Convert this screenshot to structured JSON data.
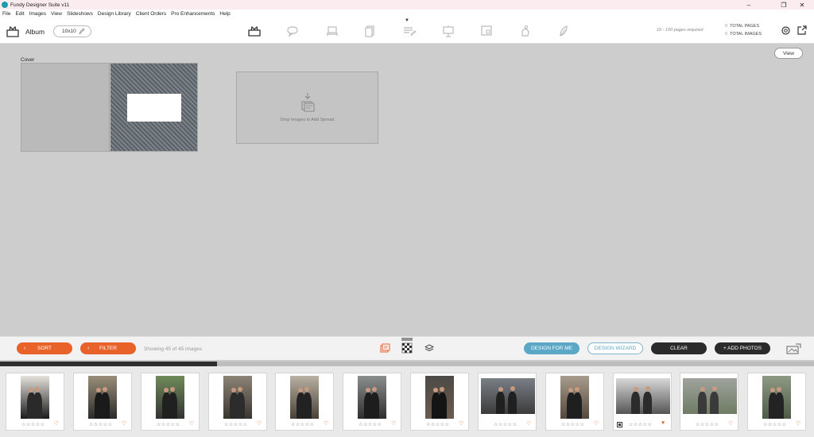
{
  "window": {
    "title": "Fundy Designer Suite v11",
    "controls": [
      "–",
      "❐",
      "✕"
    ]
  },
  "menu": [
    "File",
    "Edit",
    "Images",
    "View",
    "Slideshows",
    "Design Library",
    "Client Orders",
    "Pro Enhancements",
    "Help"
  ],
  "toolbar": {
    "product": "Album",
    "album_size": "10x10",
    "pages_required": "10 - 100 pages required",
    "total_pages_count": "0",
    "total_pages_label": "TOTAL PAGES",
    "total_images_count": "0",
    "total_images_label": "TOTAL IMAGES",
    "tools": [
      "album-icon",
      "chat-icon",
      "bed-icon",
      "pages-icon",
      "edit-list-icon",
      "presentation-icon",
      "screen-icon",
      "hand-icon",
      "leaf-icon"
    ],
    "active_tool": "edit-list-icon"
  },
  "workspace": {
    "view_label": "View",
    "cover_label": "Cover",
    "drop_text": "Drop Images to Add Spread"
  },
  "bottom": {
    "sort_label": "SORT",
    "filter_label": "FILTER",
    "showing": "Showing 45 of 45 images",
    "design_for_me": "DESIGN FOR ME",
    "design_wizard": "DESIGN WIZARD",
    "clear": "CLEAR",
    "add_photos": "+ ADD PHOTOS",
    "scroll_fraction": 0.267
  },
  "colors": {
    "accent_orange": "#e8622a",
    "teal": "#5aa7c6",
    "dark": "#2b2b2b"
  },
  "thumbnails": [
    {
      "orientation": "portrait",
      "favorite": false,
      "selected": false
    },
    {
      "orientation": "portrait",
      "favorite": false,
      "selected": false
    },
    {
      "orientation": "portrait",
      "favorite": false,
      "selected": false
    },
    {
      "orientation": "portrait",
      "favorite": false,
      "selected": false
    },
    {
      "orientation": "portrait",
      "favorite": false,
      "selected": false
    },
    {
      "orientation": "portrait",
      "favorite": false,
      "selected": false
    },
    {
      "orientation": "portrait",
      "favorite": false,
      "selected": false
    },
    {
      "orientation": "landscape",
      "favorite": false,
      "selected": false
    },
    {
      "orientation": "portrait",
      "favorite": false,
      "selected": false
    },
    {
      "orientation": "landscape",
      "favorite": true,
      "selected": true
    },
    {
      "orientation": "landscape",
      "favorite": false,
      "selected": false
    },
    {
      "orientation": "portrait",
      "favorite": false,
      "selected": false
    }
  ],
  "stars_text": "☆☆☆☆☆"
}
